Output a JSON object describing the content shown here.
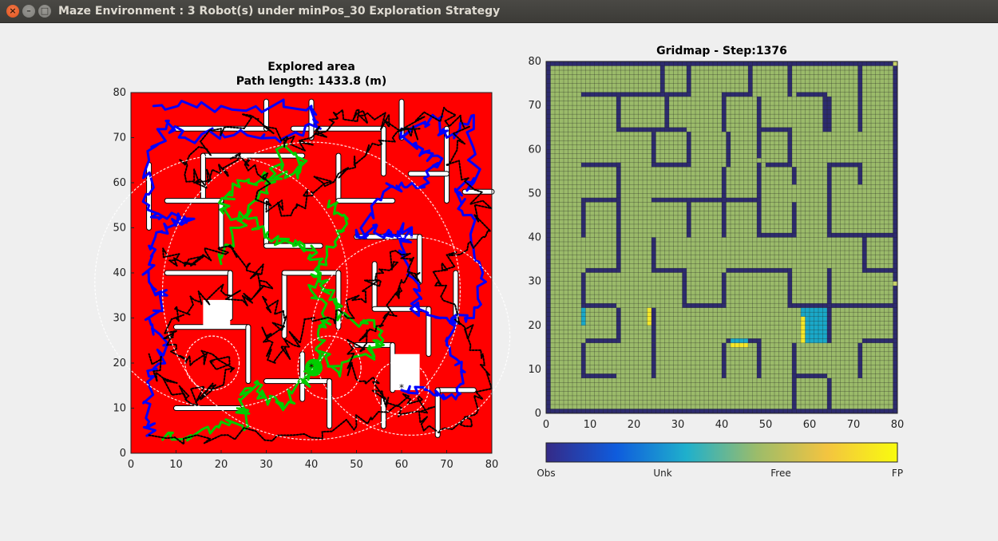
{
  "window": {
    "title": "Maze Environment : 3 Robot(s) under minPos_30 Exploration Strategy",
    "buttons": [
      "close-icon",
      "minimize-icon",
      "maximize-icon"
    ]
  },
  "left_plot": {
    "title_line1": "Explored area",
    "title_line2": "Path length: 1433.8 (m)",
    "xlim": [
      0,
      80
    ],
    "ylim": [
      0,
      80
    ],
    "xticks": [
      "0",
      "10",
      "20",
      "30",
      "40",
      "50",
      "60",
      "70",
      "80"
    ],
    "yticks": [
      "0",
      "10",
      "20",
      "30",
      "40",
      "50",
      "60",
      "70",
      "80"
    ],
    "colors": {
      "explored": "#ff0000",
      "robot1_path": "#0000ff",
      "robot2_path": "#00cc00",
      "robot3_path": "#000000",
      "sensor_circle": "#ffffff"
    },
    "robot_positions": [
      [
        18,
        20
      ],
      [
        60,
        14.5
      ],
      [
        40,
        19
      ]
    ]
  },
  "right_plot": {
    "title": "Gridmap - Step:1376",
    "xlim": [
      0,
      80
    ],
    "ylim": [
      0,
      80
    ],
    "xticks": [
      "0",
      "10",
      "20",
      "30",
      "40",
      "50",
      "60",
      "70",
      "80"
    ],
    "yticks": [
      "0",
      "10",
      "20",
      "30",
      "40",
      "50",
      "60",
      "70",
      "80"
    ],
    "colors": {
      "obs": "#2d2b6e",
      "unk": "#1aa8c8",
      "free": "#9bbb6a",
      "fp": "#f5e72a"
    }
  },
  "colorbar": {
    "labels": [
      "Obs",
      "Unk",
      "Free",
      "FP"
    ],
    "colors": [
      "#352a87",
      "#0f5cdd",
      "#1fb0cc",
      "#9cbc6a",
      "#f3c440",
      "#f9fb0e"
    ]
  }
}
